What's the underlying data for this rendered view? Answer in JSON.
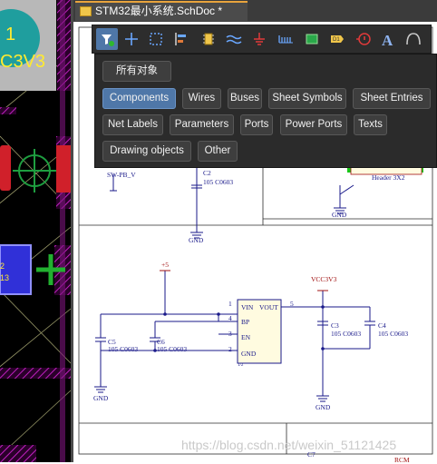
{
  "tab": {
    "title": "STM32最小系统.SchDoc *"
  },
  "pcb": {
    "big_label": "1\nC3V3",
    "pad_label": "2\n13"
  },
  "toolbar": {
    "items": [
      "filter",
      "move",
      "select-area",
      "align",
      "component",
      "bus",
      "power",
      "port",
      "sheet-symbol",
      "net-label",
      "no-erc",
      "text",
      "arc"
    ]
  },
  "popup": {
    "all_objects": "所有对象",
    "chips": [
      "Components",
      "Wires",
      "Buses",
      "Sheet Symbols",
      "Sheet Entries",
      "Net Labels",
      "Parameters",
      "Ports",
      "Power Ports",
      "Texts",
      "Drawing objects",
      "Other"
    ],
    "selected": "Components"
  },
  "schematic": {
    "sw_label": "SW-PB_V",
    "c2_ref": "C2",
    "c2_val": "105 C0603",
    "gnd": "GND",
    "header": "Header 3X2",
    "plus5": "+5",
    "vcc": "VCC3V3",
    "pin1": "1",
    "pin4": "4",
    "pin3": "3",
    "pin2": "2",
    "pin5": "5",
    "vin": "VIN",
    "vout": "VOUT",
    "bp": "BP",
    "en": "EN",
    "gnd_pin": "GND",
    "u_ref": "1/2",
    "c5_ref": "C5",
    "c5_val": "105 C0603",
    "c6_ref": "C6",
    "c6_val": "105 C0603",
    "c3_ref": "C3",
    "c3_val": "105 C0603",
    "c4_ref": "C4",
    "c4_val": "105 C0603",
    "bottom_c7": "C7",
    "bottom_rcm": "RCM"
  },
  "watermark": "https://blog.csdn.net/weixin_51121425",
  "colors": {
    "accent": "#4f77a8",
    "wire": "#1a1a8a",
    "power": "#a01010"
  }
}
